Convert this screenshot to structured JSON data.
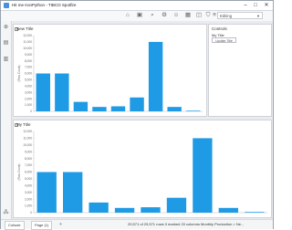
{
  "window": {
    "title": "Hit me IronPython - TIBCO Spotfire",
    "minimize": "–",
    "maximize": "□",
    "close": "✕"
  },
  "toolbar": {
    "icons": [
      "home-icon",
      "analysis-icon",
      "search-icon",
      "gear-icon",
      "people-icon",
      "grid-icon",
      "bookmark-icon",
      "filter-icon",
      "table-icon"
    ],
    "editing": "Editing"
  },
  "sidebar": {
    "icons": [
      "add-icon",
      "files-icon",
      "data-icon",
      "pages-icon"
    ]
  },
  "panels": [
    {
      "title": "New Title"
    },
    {
      "title": "My Title"
    }
  ],
  "controls": {
    "title": "Controls",
    "label": "My Title",
    "input": "Update Title"
  },
  "chart_data": [
    {
      "type": "bar",
      "title": "New Title",
      "ylabel": "(Row Count)",
      "ylim": [
        0,
        12000
      ],
      "yticks": [
        0,
        1000,
        2000,
        3000,
        4000,
        5000,
        6000,
        7000,
        8000,
        9000,
        10000,
        11000,
        12000
      ],
      "values": [
        6000,
        6000,
        1500,
        700,
        800,
        2200,
        11000,
        700,
        100
      ],
      "color": "#1f9be5",
      "grid": false
    },
    {
      "type": "bar",
      "title": "My Title",
      "ylabel": "(Row Count)",
      "ylim": [
        0,
        12000
      ],
      "yticks": [
        0,
        1000,
        2000,
        3000,
        4000,
        5000,
        6000,
        7000,
        8000,
        9000,
        10000,
        11000,
        12000
      ],
      "values": [
        6000,
        6000,
        1500,
        700,
        800,
        2200,
        11000,
        700,
        100
      ],
      "color": "#1f9be5",
      "grid": false
    }
  ],
  "status": {
    "tabs": [
      "Collude",
      "Page (1)"
    ],
    "text": "29,571 of 29,571 rows  0 marked  20 columns  Monthly Production > Ne..."
  }
}
